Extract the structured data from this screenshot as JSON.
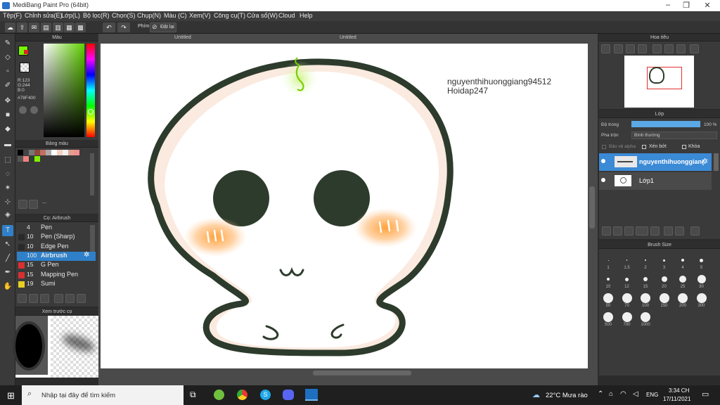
{
  "app": {
    "title": "MediBang Paint Pro (64bit)"
  },
  "menu": [
    "Tệp(F)",
    "Chỉnh sửa(E)",
    "Lớp(L)",
    "Bộ lọc(R)",
    "Chọn(S)",
    "Chụp(N)",
    "Màu (C)",
    "Xem(V)",
    "Công cụ(T)",
    "Cửa sổ(W)",
    "Cloud",
    "Help"
  ],
  "toolbar": {
    "keyboard_label": "Phím",
    "reset_label": "Đặt lại"
  },
  "tabs": [
    "Untitled",
    "Untitled"
  ],
  "color_panel": {
    "title": "Màu",
    "r": "R:123",
    "g": "G:244",
    "b": "B:0",
    "hex": "#78F400",
    "primary_color": "#78F400",
    "secondary_color": "#ffffff"
  },
  "palette_panel": {
    "title": "Bảng màu",
    "footer": "---"
  },
  "brush_panel": {
    "title": "Cọ: Airbrush",
    "items": [
      {
        "size": "4",
        "name": "Pen",
        "color": "#3a3a3a"
      },
      {
        "size": "10",
        "name": "Pen (Sharp)",
        "color": "#2a2a2a"
      },
      {
        "size": "10",
        "name": "Edge Pen",
        "color": "#2a2a2a"
      },
      {
        "size": "100",
        "name": "Airbrush",
        "color": "#2f80c8"
      },
      {
        "size": "15",
        "name": "G Pen",
        "color": "#d83030"
      },
      {
        "size": "15",
        "name": "Mapping Pen",
        "color": "#d83030"
      },
      {
        "size": "19",
        "name": "Sumi",
        "color": "#e8d020"
      }
    ]
  },
  "preview_panel": {
    "title": "Xem trước cọ"
  },
  "canvas": {
    "watermark_line1": "nguyenthihuonggiang94512",
    "watermark_line2": "Hoidap247"
  },
  "navigator": {
    "title": "Hoa tiêu"
  },
  "layer_panel": {
    "title": "Lớp",
    "opacity_label": "Độ trong",
    "opacity_value": "100 %",
    "opacity": 1.0,
    "blend_label": "Pha trộn",
    "blend_value": "Bình thường",
    "protect_alpha": "Bảo vệ alpha",
    "clipping": "Xén bớt",
    "lock": "Khóa",
    "layers": [
      {
        "name": "nguyenthihuonggiang",
        "selected": true
      },
      {
        "name": "Lớp1",
        "selected": false
      }
    ]
  },
  "brush_size_panel": {
    "title": "Brush Size",
    "sizes": [
      "1",
      "1.5",
      "2",
      "3",
      "4",
      "5",
      "10",
      "12",
      "15",
      "20",
      "25",
      "30",
      "50",
      "70",
      "100",
      "150",
      "200",
      "300",
      "500",
      "700",
      "1000"
    ]
  },
  "taskbar": {
    "search_placeholder": "Nhập tại đây để tìm kiếm",
    "weather": "22°C  Mưa rào",
    "lang": "ENG",
    "time": "3:34 CH",
    "date": "17/11/2021"
  }
}
